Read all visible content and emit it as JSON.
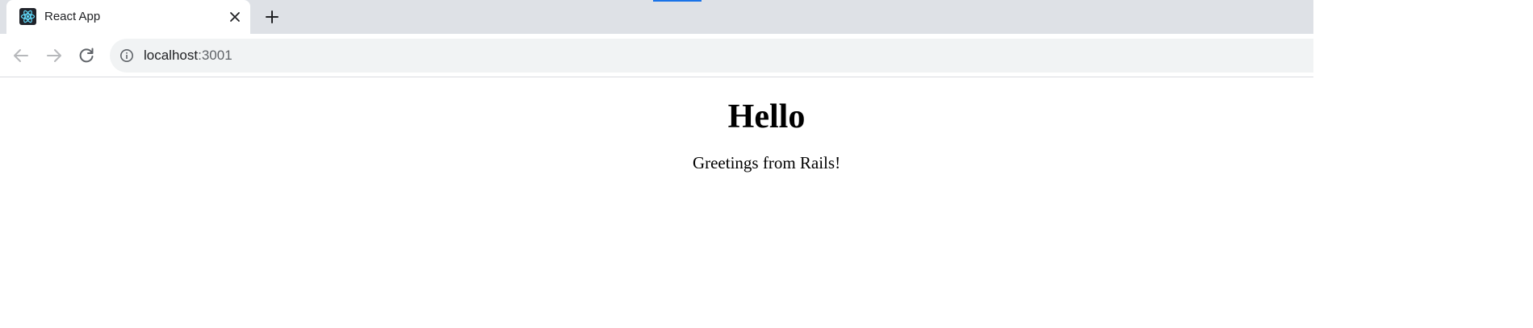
{
  "tab": {
    "title": "React App",
    "favicon_icon": "react-logo-icon",
    "close_icon": "close-icon"
  },
  "tab_strip": {
    "new_tab_icon": "plus-icon"
  },
  "toolbar": {
    "back_icon": "arrow-left-icon",
    "forward_icon": "arrow-right-icon",
    "reload_icon": "reload-icon",
    "site_info_icon": "info-icon",
    "url_host": "localhost",
    "url_port": ":3001"
  },
  "page": {
    "heading": "Hello",
    "message": "Greetings from Rails!"
  },
  "colors": {
    "tab_strip": "#dee1e6",
    "omnibox": "#f1f3f4",
    "accent": "#1a73e8",
    "react_logo": "#61dafb"
  }
}
